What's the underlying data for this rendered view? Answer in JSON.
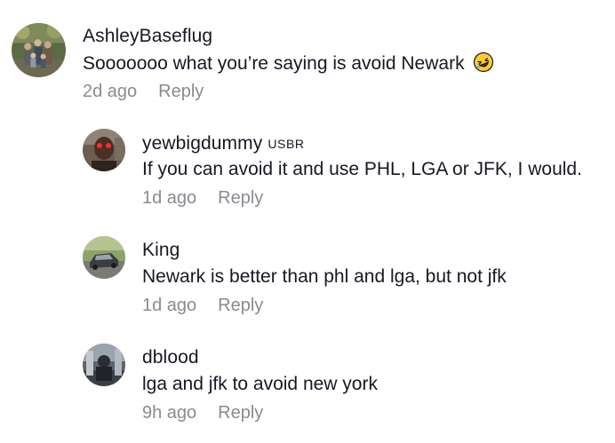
{
  "comments": [
    {
      "username": "AshleyBaseflug",
      "badge": "",
      "text": "Sooooooo what you’re saying is avoid Newark",
      "emoji": "laughing-emoji",
      "time": "2d ago",
      "reply": "Reply"
    },
    {
      "username": "yewbigdummy",
      "badge": "USBR",
      "text": "If you can avoid it and use PHL, LGA or JFK, I would.",
      "time": "1d ago",
      "reply": "Reply"
    },
    {
      "username": "King",
      "badge": "",
      "text": "Newark is better than phl and lga, but not jfk",
      "time": "1d ago",
      "reply": "Reply"
    },
    {
      "username": "dblood",
      "badge": "",
      "text": "lga and jfk to avoid new york",
      "time": "9h ago",
      "reply": "Reply"
    }
  ],
  "colors": {
    "text": "#161823",
    "meta": "#8a8b91",
    "background": "#ffffff"
  }
}
